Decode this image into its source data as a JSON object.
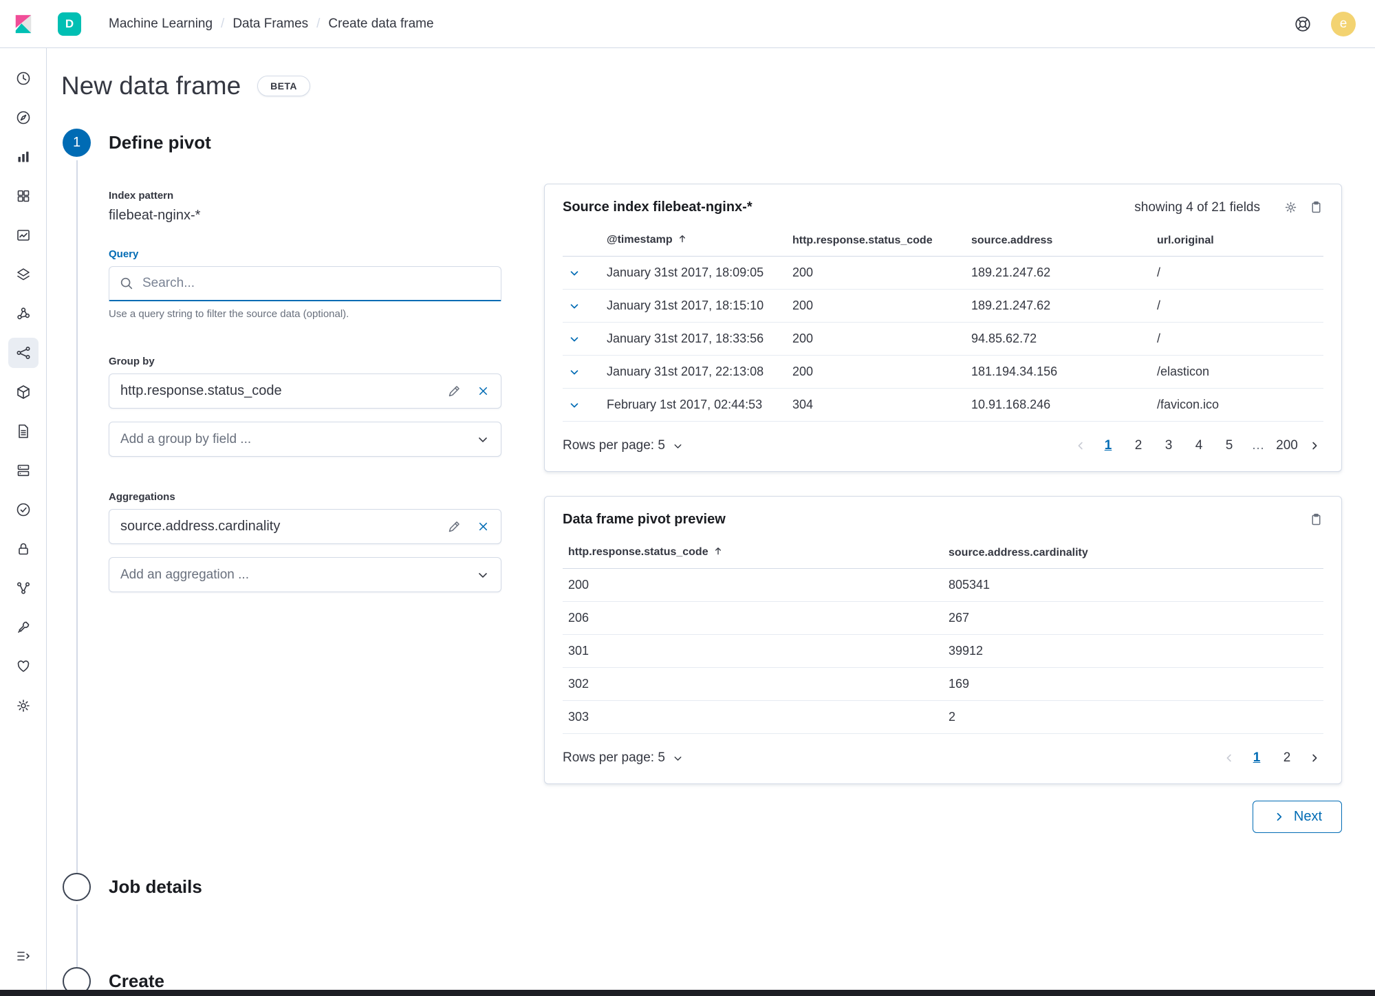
{
  "colors": {
    "primary": "#006BB4",
    "space_badge": "#00BFB3",
    "avatar": "#F3D371",
    "logo_pink": "#F04E98",
    "logo_teal": "#00BFB3"
  },
  "header": {
    "space_badge": "D",
    "breadcrumbs": [
      "Machine Learning",
      "Data Frames",
      "Create data frame"
    ],
    "separator": "/",
    "avatar_initial": "e"
  },
  "sidebar": {
    "active": "machine-learning",
    "items": [
      "recently-viewed",
      "discover",
      "visualize",
      "dashboard",
      "timelion",
      "maps",
      "graph",
      "machine-learning",
      "canvas",
      "logs",
      "infrastructure",
      "uptime",
      "security",
      "apm",
      "dev-tools",
      "monitoring",
      "management"
    ],
    "collapse": "collapse-menu"
  },
  "page": {
    "title": "New data frame",
    "beta_badge": "BETA",
    "steps": [
      {
        "number": "1",
        "label": "Define pivot"
      },
      {
        "number": "",
        "label": "Job details"
      },
      {
        "number": "",
        "label": "Create"
      }
    ]
  },
  "form": {
    "index_pattern_label": "Index pattern",
    "index_pattern_value": "filebeat-nginx-*",
    "query_label": "Query",
    "query_placeholder": "Search...",
    "query_help": "Use a query string to filter the source data (optional).",
    "group_by_label": "Group by",
    "group_by_items": [
      "http.response.status_code"
    ],
    "group_by_placeholder": "Add a group by field ...",
    "aggregations_label": "Aggregations",
    "aggregation_items": [
      "source.address.cardinality"
    ],
    "aggregation_placeholder": "Add an aggregation ..."
  },
  "source_index_panel": {
    "title": "Source index filebeat-nginx-*",
    "fields_info": "showing 4 of 21 fields",
    "columns": [
      "@timestamp",
      "http.response.status_code",
      "source.address",
      "url.original"
    ],
    "rows": [
      {
        "timestamp": "January 31st 2017, 18:09:05",
        "status": "200",
        "address": "189.21.247.62",
        "url": "/"
      },
      {
        "timestamp": "January 31st 2017, 18:15:10",
        "status": "200",
        "address": "189.21.247.62",
        "url": "/"
      },
      {
        "timestamp": "January 31st 2017, 18:33:56",
        "status": "200",
        "address": "94.85.62.72",
        "url": "/"
      },
      {
        "timestamp": "January 31st 2017, 22:13:08",
        "status": "200",
        "address": "181.194.34.156",
        "url": "/elasticon"
      },
      {
        "timestamp": "February 1st 2017, 02:44:53",
        "status": "304",
        "address": "10.91.168.246",
        "url": "/favicon.ico"
      }
    ],
    "rows_per_page": "Rows per page: 5",
    "pages": [
      "1",
      "2",
      "3",
      "4",
      "5",
      "…",
      "200"
    ],
    "active_page": "1"
  },
  "pivot_panel": {
    "title": "Data frame pivot preview",
    "columns": [
      "http.response.status_code",
      "source.address.cardinality"
    ],
    "rows": [
      [
        "200",
        "805341"
      ],
      [
        "206",
        "267"
      ],
      [
        "301",
        "39912"
      ],
      [
        "302",
        "169"
      ],
      [
        "303",
        "2"
      ]
    ],
    "rows_per_page": "Rows per page: 5",
    "pages": [
      "1",
      "2"
    ],
    "active_page": "1"
  },
  "next_button": "Next"
}
